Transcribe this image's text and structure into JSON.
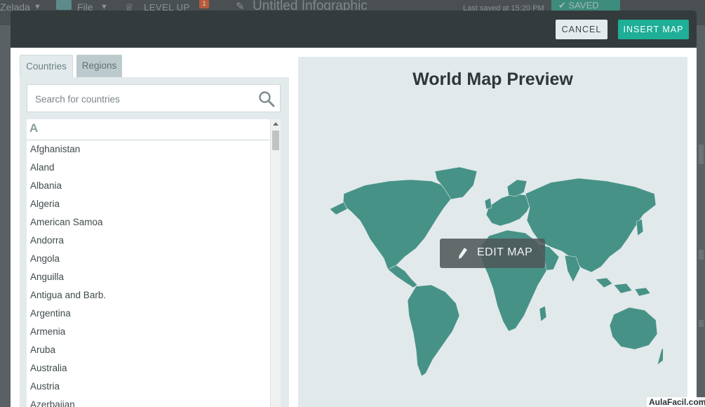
{
  "background_app": {
    "user": "Zelada",
    "file_menu": "File",
    "level_up": "LEVEL UP",
    "notification_count": "1",
    "document_title": "Untitled Infographic",
    "last_saved": "Last saved at 15:20 PM",
    "saved_label": "SAVED"
  },
  "header": {
    "cancel_label": "CANCEL",
    "insert_label": "INSERT MAP"
  },
  "tabs": [
    {
      "label": "Countries",
      "active": true
    },
    {
      "label": "Regions",
      "active": false
    }
  ],
  "search": {
    "placeholder": "Search for countries",
    "value": ""
  },
  "list": {
    "letter": "A",
    "countries": [
      "Afghanistan",
      "Aland",
      "Albania",
      "Algeria",
      "American Samoa",
      "Andorra",
      "Angola",
      "Anguilla",
      "Antigua and Barb.",
      "Argentina",
      "Armenia",
      "Aruba",
      "Australia",
      "Austria",
      "Azerbaijan"
    ]
  },
  "preview": {
    "title": "World Map Preview",
    "edit_label": "EDIT MAP",
    "map_color": "#479287"
  },
  "icons": {
    "search": "search-icon",
    "edit": "pencil-icon"
  },
  "watermark": "AulaFacil.com"
}
